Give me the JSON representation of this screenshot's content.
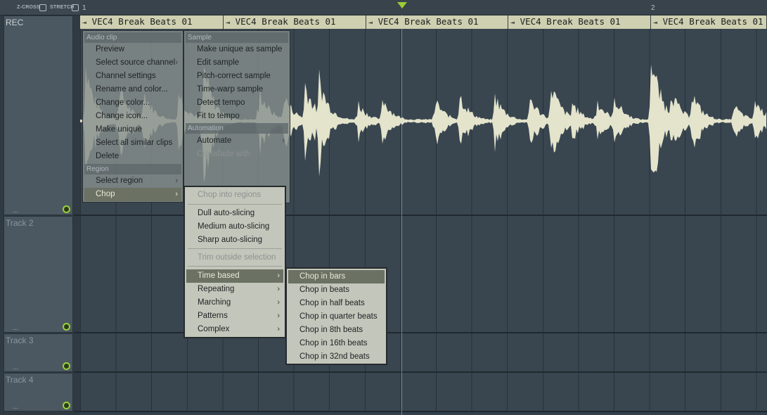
{
  "toolbar": {
    "zcross_label": "Z-CROSS",
    "stretch_label": "STRETCH"
  },
  "ruler": {
    "bar_1": "1",
    "bar_2": "2"
  },
  "tracks": [
    {
      "name": "REC"
    },
    {
      "name": "Track 2"
    },
    {
      "name": "Track 3"
    },
    {
      "name": "Track 4"
    }
  ],
  "clips": [
    {
      "title": "VEC4 Break Beats 01"
    },
    {
      "title": "VEC4 Break Beats 01"
    },
    {
      "title": "VEC4 Break Beats 01"
    },
    {
      "title": "VEC4 Break Beats 01"
    },
    {
      "title": "VEC4 Break Beats 01"
    }
  ],
  "clip_menu": {
    "header_audio": "Audio clip",
    "preview": "Preview",
    "select_source_channel": "Select source channel",
    "channel_settings": "Channel settings",
    "rename_color": "Rename and color...",
    "change_color": "Change color...",
    "change_icon": "Change icon...",
    "make_unique": "Make unique",
    "select_similar": "Select all similar clips",
    "delete": "Delete",
    "header_region": "Region",
    "select_region": "Select region",
    "chop": "Chop"
  },
  "sample_menu": {
    "header_sample": "Sample",
    "make_unique_sample": "Make unique as sample",
    "edit_sample": "Edit sample",
    "pitch_correct": "Pitch-correct sample",
    "time_warp": "Time-warp sample",
    "detect_tempo": "Detect tempo",
    "fit_tempo": "Fit to tempo",
    "header_automation": "Automation",
    "automate": "Automate",
    "crossfade": "Crossfade with"
  },
  "chop_menu": {
    "chop_regions": "Chop into regions",
    "dull": "Dull auto-slicing",
    "medium": "Medium auto-slicing",
    "sharp": "Sharp auto-slicing",
    "trim": "Trim outside selection",
    "time_based": "Time based",
    "repeating": "Repeating",
    "marching": "Marching",
    "patterns": "Patterns",
    "complex": "Complex"
  },
  "time_menu": {
    "bars": "Chop in bars",
    "beats": "Chop in beats",
    "half": "Chop in half beats",
    "quarter": "Chop in quarter beats",
    "eighth": "Chop in 8th beats",
    "sixteenth": "Chop in 16th beats",
    "thirtysecond": "Chop in 32nd beats"
  },
  "colors": {
    "clip": "#cfd0b1",
    "waveform": "#e4e4cc",
    "accent": "#9ccb35",
    "lane": "#394650"
  },
  "icons": {
    "clip": "clip-arrow-icon",
    "submenu": "chevron-right-icon",
    "playhead": "playhead-marker-icon",
    "track_led": "track-led-icon"
  }
}
